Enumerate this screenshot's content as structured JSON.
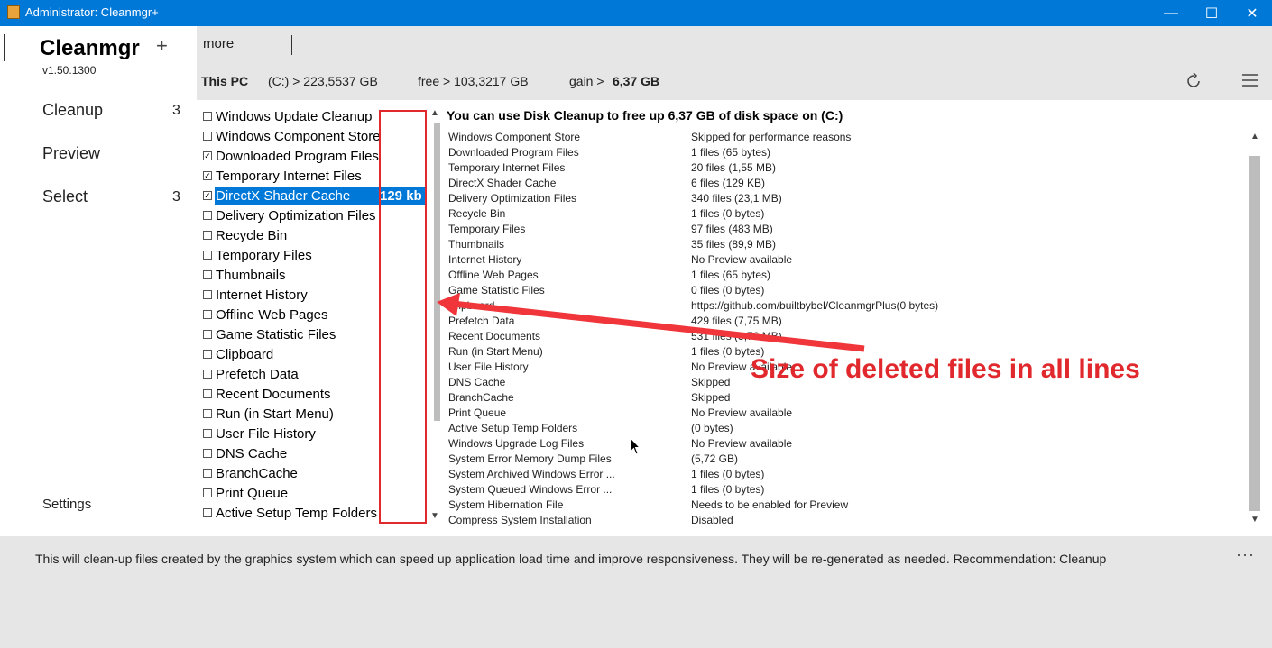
{
  "window": {
    "title": "Administrator: Cleanmgr+",
    "minimize": "—",
    "maximize": "☐",
    "close": "✕"
  },
  "sidebar": {
    "app_name": "Cleanmgr",
    "version": "v1.50.1300",
    "items": [
      {
        "label": "Cleanup",
        "count": "3"
      },
      {
        "label": "Preview",
        "count": ""
      },
      {
        "label": "Select",
        "count": "3"
      }
    ],
    "settings": "Settings"
  },
  "tabs": {
    "add": "+",
    "more": "more"
  },
  "info": {
    "pc": "This PC",
    "drive": "(C:) > 223,5537 GB",
    "free": "free >  103,3217 GB",
    "gain_label": "gain >",
    "gain_value": "6,37 GB"
  },
  "checklist": [
    {
      "label": "Windows Update Cleanup",
      "checked": false
    },
    {
      "label": "Windows Component Store",
      "checked": false
    },
    {
      "label": "Downloaded Program Files",
      "checked": true
    },
    {
      "label": "Temporary Internet Files",
      "checked": true
    },
    {
      "label": "DirectX Shader Cache",
      "checked": true,
      "selected": true,
      "size": "129 kb"
    },
    {
      "label": "Delivery Optimization Files",
      "checked": false
    },
    {
      "label": "Recycle Bin",
      "checked": false
    },
    {
      "label": "Temporary Files",
      "checked": false
    },
    {
      "label": "Thumbnails",
      "checked": false
    },
    {
      "label": "Internet History",
      "checked": false
    },
    {
      "label": "Offline Web Pages",
      "checked": false
    },
    {
      "label": "Game Statistic Files",
      "checked": false
    },
    {
      "label": "Clipboard",
      "checked": false
    },
    {
      "label": "Prefetch Data",
      "checked": false
    },
    {
      "label": "Recent Documents",
      "checked": false
    },
    {
      "label": "Run (in Start Menu)",
      "checked": false
    },
    {
      "label": "User File History",
      "checked": false
    },
    {
      "label": "DNS Cache",
      "checked": false
    },
    {
      "label": "BranchCache",
      "checked": false
    },
    {
      "label": "Print Queue",
      "checked": false
    },
    {
      "label": "Active Setup Temp Folders",
      "checked": false
    }
  ],
  "preview": {
    "heading": "You can use Disk Cleanup to free up 6,37 GB of disk space on (C:)",
    "rows": [
      {
        "name": "Windows Component Store",
        "value": "Skipped for performance reasons"
      },
      {
        "name": "Downloaded Program Files",
        "value": "1 files (65 bytes)"
      },
      {
        "name": "Temporary Internet Files",
        "value": "20 files (1,55 MB)"
      },
      {
        "name": "DirectX Shader Cache",
        "value": "6 files (129 KB)"
      },
      {
        "name": "Delivery Optimization Files",
        "value": "340 files (23,1 MB)"
      },
      {
        "name": "Recycle Bin",
        "value": "1 files (0 bytes)"
      },
      {
        "name": "Temporary Files",
        "value": "97 files (483 MB)"
      },
      {
        "name": "Thumbnails",
        "value": "35 files (89,9 MB)"
      },
      {
        "name": "Internet History",
        "value": "No Preview available"
      },
      {
        "name": "Offline Web Pages",
        "value": "1 files (65 bytes)"
      },
      {
        "name": "Game Statistic Files",
        "value": "0 files (0 bytes)"
      },
      {
        "name": "Clipboard",
        "value": "https://github.com/builtbybel/CleanmgrPlus(0 bytes)"
      },
      {
        "name": "Prefetch Data",
        "value": "429 files (7,75 MB)"
      },
      {
        "name": "Recent Documents",
        "value": "531 files (3,76 MB)"
      },
      {
        "name": "Run (in Start Menu)",
        "value": "1 files (0 bytes)"
      },
      {
        "name": "User File History",
        "value": "No Preview available"
      },
      {
        "name": "DNS Cache",
        "value": "Skipped"
      },
      {
        "name": "BranchCache",
        "value": "Skipped"
      },
      {
        "name": "Print Queue",
        "value": "No Preview available"
      },
      {
        "name": "Active Setup Temp Folders",
        "value": "(0 bytes)"
      },
      {
        "name": "Windows Upgrade Log Files",
        "value": "No Preview available"
      },
      {
        "name": "System Error Memory Dump Files",
        "value": "(5,72 GB)"
      },
      {
        "name": "System Archived Windows Error ...",
        "value": "1 files (0 bytes)"
      },
      {
        "name": "System Queued Windows Error ...",
        "value": "1 files (0 bytes)"
      },
      {
        "name": "System Hibernation File",
        "value": "Needs to be enabled for Preview"
      },
      {
        "name": "Compress System Installation",
        "value": "Disabled"
      }
    ]
  },
  "annotation": {
    "text": "Size of deleted files in all lines",
    "color": "#e0282d"
  },
  "footer": {
    "description": "This will clean-up files created by the graphics system which can speed up application load time and improve responsiveness. They will be re-generated as needed. Recommendation: Cleanup",
    "more": "···"
  },
  "colors": {
    "titlebar": "#0078d7",
    "selection": "#0078d7",
    "annotation": "#e0282d"
  }
}
